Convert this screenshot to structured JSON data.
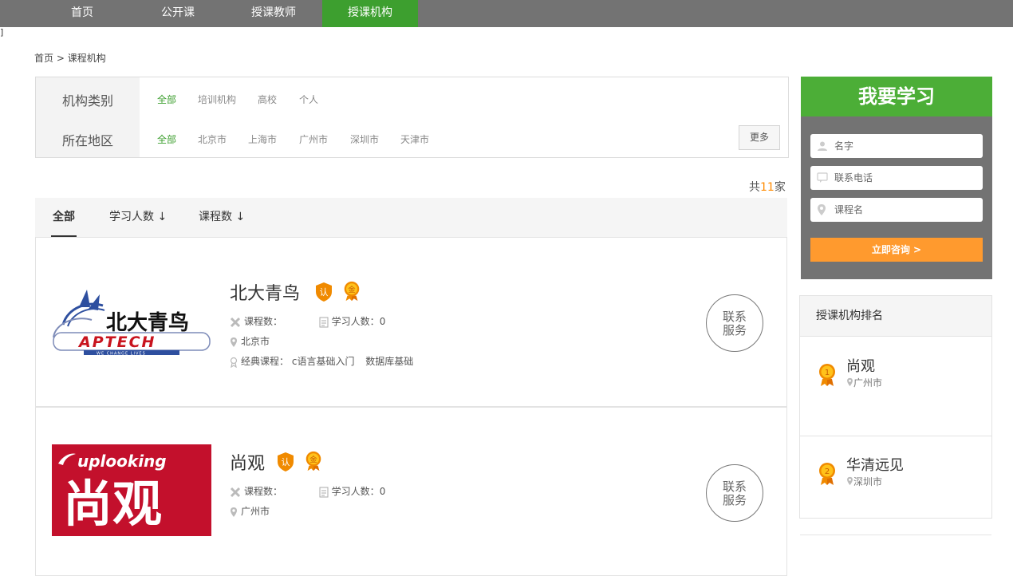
{
  "nav": {
    "items": [
      {
        "label": "首页"
      },
      {
        "label": "公开课"
      },
      {
        "label": "授课教师"
      },
      {
        "label": "授课机构"
      }
    ],
    "active_index": 3,
    "bg_color": "#737373",
    "active_color": "#3d9f2f"
  },
  "stray_char": "]",
  "breadcrumb": {
    "home": "首页",
    "sep": ">",
    "current": "课程机构"
  },
  "filters": {
    "category": {
      "label": "机构类别",
      "options": [
        "全部",
        "培训机构",
        "高校",
        "个人"
      ],
      "selected": "全部"
    },
    "region": {
      "label": "所在地区",
      "options": [
        "全部",
        "北京市",
        "上海市",
        "广州市",
        "深圳市",
        "天津市"
      ],
      "selected": "全部"
    },
    "more_label": "更多"
  },
  "total": {
    "prefix": "共",
    "count": "11",
    "suffix": "家"
  },
  "sort_tabs": [
    {
      "label": "全部"
    },
    {
      "label": "学习人数 ↓"
    },
    {
      "label": "课程数 ↓"
    }
  ],
  "orgs": [
    {
      "name": "北大青鸟",
      "logo_text": "北大青鸟",
      "logo_sub": "APTECH",
      "logo_tagline": "WE CHANGE LIVES",
      "badge_cert": "认",
      "badge_gold": "金",
      "courses_label": "课程数：",
      "courses_value": "",
      "students_label": "学习人数：",
      "students_value": "0",
      "city": "北京市",
      "classic_label": "经典课程：",
      "classic_courses": [
        "c语言基础入门",
        "数据库基础"
      ],
      "contact_label_1": "联系",
      "contact_label_2": "服务"
    },
    {
      "name": "尚观",
      "logo_text": "尚观",
      "logo_sub": "uplooking",
      "badge_cert": "认",
      "badge_gold": "金",
      "courses_label": "课程数：",
      "courses_value": "",
      "students_label": "学习人数：",
      "students_value": "0",
      "city": "广州市",
      "contact_label_1": "联系",
      "contact_label_2": "服务"
    }
  ],
  "learn_form": {
    "title": "我要学习",
    "name_placeholder": "名字",
    "phone_placeholder": "联系电话",
    "course_placeholder": "课程名",
    "submit_label": "立即咨询 >",
    "header_color": "#4cae37",
    "button_color": "#ff9a2e"
  },
  "ranking": {
    "title": "授课机构排名",
    "items": [
      {
        "rank": "1",
        "name": "尚观",
        "city": "广州市"
      },
      {
        "rank": "2",
        "name": "华清远见",
        "city": "深圳市"
      }
    ]
  }
}
